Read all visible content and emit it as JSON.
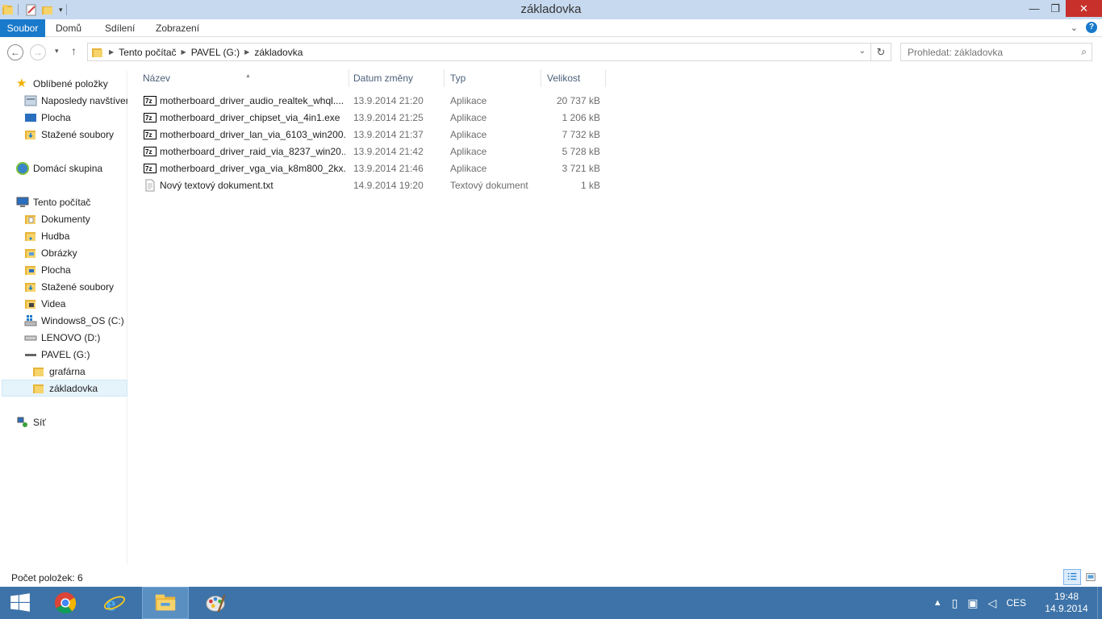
{
  "window": {
    "title": "základovka",
    "minimize": "—",
    "maximize": "❐",
    "close": "✕"
  },
  "ribbon": {
    "tabs": [
      "Soubor",
      "Domů",
      "Sdílení",
      "Zobrazení"
    ]
  },
  "address": {
    "crumbs": [
      "Tento počítač",
      "PAVEL (G:)",
      "základovka"
    ],
    "search_placeholder": "Prohledat: základovka"
  },
  "nav": {
    "favorites": "Oblíbené položky",
    "recent": "Naposledy navštívené",
    "desktop": "Plocha",
    "downloads": "Stažené soubory",
    "homegroup": "Domácí skupina",
    "this_pc": "Tento počítač",
    "documents": "Dokumenty",
    "music": "Hudba",
    "pictures": "Obrázky",
    "desktop2": "Plocha",
    "downloads2": "Stažené soubory",
    "videos": "Videa",
    "drive_c": "Windows8_OS (C:)",
    "drive_d": "LENOVO (D:)",
    "drive_g": "PAVEL (G:)",
    "folder_grafarna": "grafárna",
    "folder_zakladovka": "základovka",
    "network": "Síť"
  },
  "columns": {
    "name": "Název",
    "date": "Datum změny",
    "type": "Typ",
    "size": "Velikost"
  },
  "files": [
    {
      "name": "motherboard_driver_audio_realtek_whql....",
      "date": "13.9.2014 21:20",
      "type": "Aplikace",
      "size": "20 737 kB",
      "icon": "7zip-exe-icon"
    },
    {
      "name": "motherboard_driver_chipset_via_4in1.exe",
      "date": "13.9.2014 21:25",
      "type": "Aplikace",
      "size": "1 206 kB",
      "icon": "7zip-exe-icon"
    },
    {
      "name": "motherboard_driver_lan_via_6103_win200...",
      "date": "13.9.2014 21:37",
      "type": "Aplikace",
      "size": "7 732 kB",
      "icon": "7zip-exe-icon"
    },
    {
      "name": "motherboard_driver_raid_via_8237_win20...",
      "date": "13.9.2014 21:42",
      "type": "Aplikace",
      "size": "5 728 kB",
      "icon": "7zip-exe-icon"
    },
    {
      "name": "motherboard_driver_vga_via_k8m800_2kx...",
      "date": "13.9.2014 21:46",
      "type": "Aplikace",
      "size": "3 721 kB",
      "icon": "7zip-exe-icon"
    },
    {
      "name": "Nový textový dokument.txt",
      "date": "14.9.2014 19:20",
      "type": "Textový dokument",
      "size": "1 kB",
      "icon": "text-file-icon"
    }
  ],
  "status": {
    "item_count": "Počet položek: 6"
  },
  "taskbar": {
    "lang": "CES",
    "time": "19:48",
    "date": "14.9.2014"
  },
  "colors": {
    "titlebar": "#c6d9ef",
    "file_tab": "#1979ca",
    "taskbar": "#3d73a8",
    "close": "#c7302b"
  }
}
